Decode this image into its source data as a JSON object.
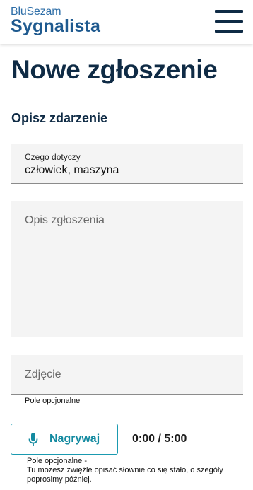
{
  "header": {
    "logo_top": "BluSezam",
    "logo_bottom": "Sygnalista",
    "menu_icon": "hamburger-menu-icon"
  },
  "page": {
    "title": "Nowe zgłoszenie",
    "section_title": "Opisz zdarzenie"
  },
  "form": {
    "subject": {
      "label": "Czego dotyczy",
      "value": "człowiek, maszyna"
    },
    "description": {
      "placeholder": "Opis zgłoszenia"
    },
    "photo": {
      "placeholder": "Zdjęcie",
      "hint": "Pole opcjonalne"
    },
    "recording": {
      "button_label": "Nagrywaj",
      "icon": "microphone-icon",
      "timer": "0:00 / 5:00",
      "hint_line1": "Pole opcjonalne -",
      "hint_line2": "Tu możesz zwięźle opisać słownie co się stało, o szegóły poprosimy później."
    }
  },
  "colors": {
    "navy": "#0f2b45",
    "brand_blue": "#1f5a8f",
    "teal": "#138aa0",
    "field_bg": "#f4f4f4"
  }
}
